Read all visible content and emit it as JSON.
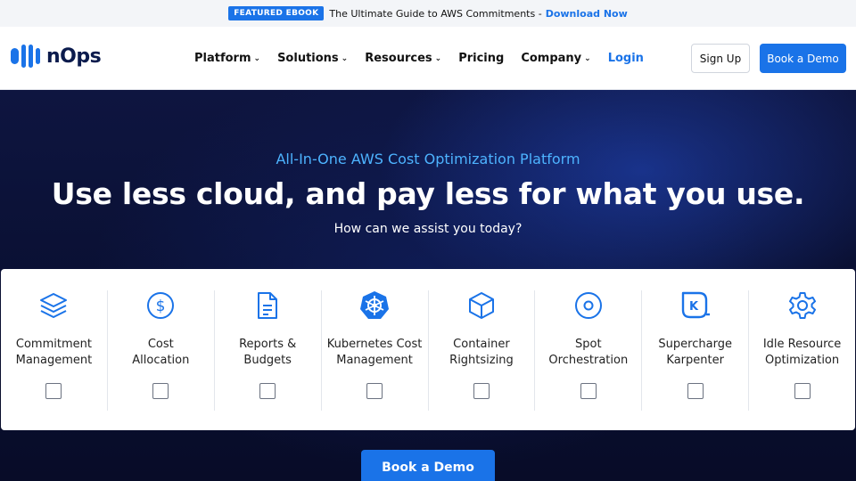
{
  "announcement": {
    "badge": "FEATURED EBOOK",
    "message": "The Ultimate Guide to AWS Commitments -",
    "link": "Download Now"
  },
  "header": {
    "logo_text": "nOps",
    "nav": [
      {
        "label": "Platform",
        "has_dropdown": true
      },
      {
        "label": "Solutions",
        "has_dropdown": true
      },
      {
        "label": "Resources",
        "has_dropdown": true
      },
      {
        "label": "Pricing",
        "has_dropdown": false
      },
      {
        "label": "Company",
        "has_dropdown": true
      },
      {
        "label": "Login",
        "has_dropdown": false
      }
    ],
    "signup_label": "Sign Up",
    "demo_label": "Book a Demo"
  },
  "hero": {
    "eyebrow": "All-In-One AWS Cost Optimization Platform",
    "headline": "Use less cloud, and pay less for what you use.",
    "subhead": "How can we assist you today?",
    "options": [
      {
        "line1": "Commitment",
        "line2": "Management",
        "icon": "layers-icon",
        "checked": false
      },
      {
        "line1": "Cost",
        "line2": "Allocation",
        "icon": "dollar-circle-icon",
        "checked": false
      },
      {
        "line1": "Reports &",
        "line2": "Budgets",
        "icon": "document-icon",
        "checked": false
      },
      {
        "line1": "Kubernetes Cost",
        "line2": "Management",
        "icon": "kubernetes-icon",
        "checked": false
      },
      {
        "line1": "Container",
        "line2": "Rightsizing",
        "icon": "cube-icon",
        "checked": false
      },
      {
        "line1": "Spot",
        "line2": "Orchestration",
        "icon": "target-circle-icon",
        "checked": false
      },
      {
        "line1": "Supercharge",
        "line2": "Karpenter",
        "icon": "karpenter-icon",
        "checked": false
      },
      {
        "line1": "Idle Resource",
        "line2": "Optimization",
        "icon": "gear-icon",
        "checked": false
      }
    ],
    "cta_label": "Book a Demo"
  },
  "colors": {
    "accent": "#1a73e8",
    "eyebrow": "#4db3ff",
    "hero_bg": "#0a1033"
  }
}
